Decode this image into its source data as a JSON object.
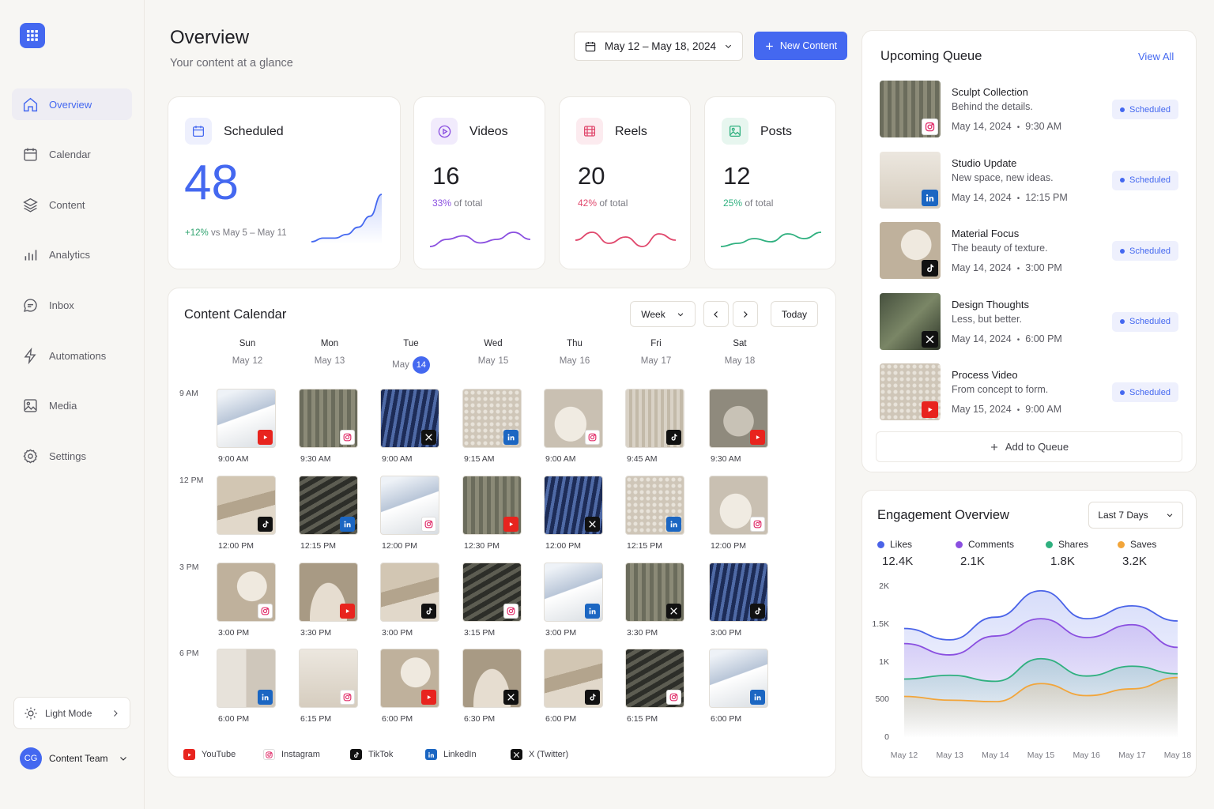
{
  "nav": {
    "items": [
      {
        "label": "Overview",
        "icon": "home-icon"
      },
      {
        "label": "Calendar",
        "icon": "calendar-icon"
      },
      {
        "label": "Content",
        "icon": "layers-icon"
      },
      {
        "label": "Analytics",
        "icon": "bar-chart-icon"
      },
      {
        "label": "Inbox",
        "icon": "message-icon"
      },
      {
        "label": "Automations",
        "icon": "lightning-icon"
      },
      {
        "label": "Media",
        "icon": "image-icon"
      },
      {
        "label": "Settings",
        "icon": "gear-icon"
      }
    ],
    "theme_label": "Light Mode",
    "team_initials": "CG",
    "team_name": "Content Team"
  },
  "header": {
    "title": "Overview",
    "subtitle": "Your content at a glance",
    "date_range": "May 12 – May 18, 2024",
    "new_button": "New Content"
  },
  "stats": {
    "scheduled": {
      "title": "Scheduled",
      "value": "48",
      "change": "+12%",
      "change_text": "vs May 5 – May 11"
    },
    "videos": {
      "title": "Videos",
      "value": "16",
      "pct": "33%",
      "pct_text": "of total"
    },
    "reels": {
      "title": "Reels",
      "value": "20",
      "pct": "42%",
      "pct_text": "of total"
    },
    "posts": {
      "title": "Posts",
      "value": "12",
      "pct": "25%",
      "pct_text": "of total"
    }
  },
  "calendar": {
    "title": "Content Calendar",
    "view": "Week",
    "today_button": "Today",
    "days": [
      {
        "name": "Sun",
        "month": "May",
        "day": "12",
        "today": false
      },
      {
        "name": "Mon",
        "month": "May",
        "day": "13",
        "today": false
      },
      {
        "name": "Tue",
        "month": "May",
        "day": "14",
        "today": true
      },
      {
        "name": "Wed",
        "month": "May",
        "day": "15",
        "today": false
      },
      {
        "name": "Thu",
        "month": "May",
        "day": "16",
        "today": false
      },
      {
        "name": "Fri",
        "month": "May",
        "day": "17",
        "today": false
      },
      {
        "name": "Sat",
        "month": "May",
        "day": "18",
        "today": false
      }
    ],
    "time_labels": [
      "9 AM",
      "12 PM",
      "3 PM",
      "6 PM"
    ],
    "slots": [
      [
        {
          "time": "9:00 AM",
          "platform": "youtube"
        },
        {
          "time": "9:30 AM",
          "platform": "instagram"
        },
        {
          "time": "9:00 AM",
          "platform": "x"
        },
        {
          "time": "9:15 AM",
          "platform": "linkedin"
        },
        {
          "time": "9:00 AM",
          "platform": "instagram"
        },
        {
          "time": "9:45 AM",
          "platform": "tiktok"
        },
        {
          "time": "9:30 AM",
          "platform": "youtube"
        }
      ],
      [
        {
          "time": "12:00 PM",
          "platform": "tiktok"
        },
        {
          "time": "12:15 PM",
          "platform": "linkedin"
        },
        {
          "time": "12:00 PM",
          "platform": "instagram"
        },
        {
          "time": "12:30 PM",
          "platform": "youtube"
        },
        {
          "time": "12:00 PM",
          "platform": "x"
        },
        {
          "time": "12:15 PM",
          "platform": "linkedin"
        },
        {
          "time": "12:00 PM",
          "platform": "instagram"
        }
      ],
      [
        {
          "time": "3:00 PM",
          "platform": "instagram"
        },
        {
          "time": "3:30 PM",
          "platform": "youtube"
        },
        {
          "time": "3:00 PM",
          "platform": "tiktok"
        },
        {
          "time": "3:15 PM",
          "platform": "instagram"
        },
        {
          "time": "3:00 PM",
          "platform": "linkedin"
        },
        {
          "time": "3:30 PM",
          "platform": "x"
        },
        {
          "time": "3:00 PM",
          "platform": "tiktok"
        }
      ],
      [
        {
          "time": "6:00 PM",
          "platform": "linkedin"
        },
        {
          "time": "6:15 PM",
          "platform": "instagram"
        },
        {
          "time": "6:00 PM",
          "platform": "youtube"
        },
        {
          "time": "6:30 PM",
          "platform": "x"
        },
        {
          "time": "6:00 PM",
          "platform": "tiktok"
        },
        {
          "time": "6:15 PM",
          "platform": "instagram"
        },
        {
          "time": "6:00 PM",
          "platform": "linkedin"
        }
      ]
    ],
    "legend": [
      {
        "platform": "youtube",
        "label": "YouTube"
      },
      {
        "platform": "instagram",
        "label": "Instagram"
      },
      {
        "platform": "tiktok",
        "label": "TikTok"
      },
      {
        "platform": "linkedin",
        "label": "LinkedIn"
      },
      {
        "platform": "x",
        "label": "X (Twitter)"
      }
    ]
  },
  "queue": {
    "title": "Upcoming Queue",
    "view_all": "View All",
    "add_label": "Add to Queue",
    "items": [
      {
        "title": "Sculpt Collection",
        "subtitle": "Behind the details.",
        "date": "May 14, 2024",
        "time": "9:30 AM",
        "status": "Scheduled",
        "platform": "instagram"
      },
      {
        "title": "Studio Update",
        "subtitle": "New space, new ideas.",
        "date": "May 14, 2024",
        "time": "12:15 PM",
        "status": "Scheduled",
        "platform": "linkedin"
      },
      {
        "title": "Material Focus",
        "subtitle": "The beauty of texture.",
        "date": "May 14, 2024",
        "time": "3:00 PM",
        "status": "Scheduled",
        "platform": "tiktok"
      },
      {
        "title": "Design Thoughts",
        "subtitle": "Less, but better.",
        "date": "May 14, 2024",
        "time": "6:00 PM",
        "status": "Scheduled",
        "platform": "x"
      },
      {
        "title": "Process Video",
        "subtitle": "From concept to form.",
        "date": "May 15, 2024",
        "time": "9:00 AM",
        "status": "Scheduled",
        "platform": "youtube"
      }
    ]
  },
  "engagement": {
    "title": "Engagement Overview",
    "range": "Last 7 Days",
    "metrics": [
      {
        "label": "Likes",
        "value": "12.4K",
        "color": "#4a63e8"
      },
      {
        "label": "Comments",
        "value": "2.1K",
        "color": "#8a4fe0"
      },
      {
        "label": "Shares",
        "value": "1.8K",
        "color": "#2fb07f"
      },
      {
        "label": "Saves",
        "value": "3.2K",
        "color": "#f2a53a"
      }
    ]
  },
  "chart_data": {
    "type": "area",
    "x": [
      "May 12",
      "May 13",
      "May 14",
      "May 15",
      "May 16",
      "May 17",
      "May 18"
    ],
    "ylim": [
      0,
      2000
    ],
    "yticks": [
      "0",
      "500",
      "1K",
      "1.5K",
      "2K"
    ],
    "series": [
      {
        "name": "Likes",
        "color": "#4a63e8",
        "values": [
          1450,
          1300,
          1600,
          1950,
          1580,
          1750,
          1550
        ]
      },
      {
        "name": "Comments",
        "color": "#8a4fe0",
        "values": [
          1250,
          1100,
          1350,
          1580,
          1330,
          1500,
          1200
        ]
      },
      {
        "name": "Shares",
        "color": "#2fb07f",
        "values": [
          780,
          830,
          750,
          1050,
          820,
          950,
          850
        ]
      },
      {
        "name": "Saves",
        "color": "#f2a53a",
        "values": [
          550,
          500,
          480,
          720,
          560,
          650,
          800
        ]
      }
    ]
  },
  "sparklines": {
    "scheduled": [
      2,
      3,
      3,
      4,
      6,
      9,
      15
    ],
    "videos": [
      4,
      5,
      5.5,
      4.5,
      5,
      6,
      5
    ],
    "reels": [
      5,
      5.5,
      4.8,
      5.2,
      4.6,
      5.4,
      5
    ],
    "posts": [
      4,
      4.2,
      4.5,
      4.3,
      4.8,
      4.5,
      4.9
    ]
  }
}
